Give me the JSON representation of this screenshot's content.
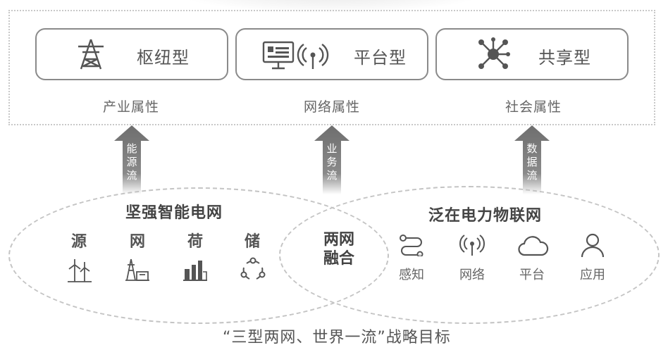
{
  "types": [
    {
      "label": "枢纽型",
      "icon": "transmission-tower-icon",
      "attribute": "产业属性"
    },
    {
      "label": "平台型",
      "icon": "monitor-wifi-icon",
      "attribute": "网络属性"
    },
    {
      "label": "共享型",
      "icon": "network-hub-icon",
      "attribute": "社会属性"
    }
  ],
  "flows": [
    {
      "text": "能源流"
    },
    {
      "text": "业务流"
    },
    {
      "text": "数据流"
    }
  ],
  "left_circle": {
    "title": "坚强智能电网",
    "items": [
      {
        "label": "源",
        "icon": "wind-turbine-icon"
      },
      {
        "label": "网",
        "icon": "power-station-icon"
      },
      {
        "label": "荷",
        "icon": "factory-icon"
      },
      {
        "label": "储",
        "icon": "storage-cycle-icon"
      }
    ]
  },
  "right_circle": {
    "title": "泛在电力物联网",
    "items": [
      {
        "label": "感知",
        "icon": "sensing-icon"
      },
      {
        "label": "网络",
        "icon": "signal-icon"
      },
      {
        "label": "平台",
        "icon": "cloud-icon"
      },
      {
        "label": "应用",
        "icon": "user-icon"
      }
    ]
  },
  "fusion": {
    "line1": "两网",
    "line2": "融合"
  },
  "footer": "“三型两网、世界一流”战略目标",
  "colors": {
    "arrow": "#7a7a7a",
    "border": "#8a8a8a",
    "dashed": "#c4c4c4"
  }
}
